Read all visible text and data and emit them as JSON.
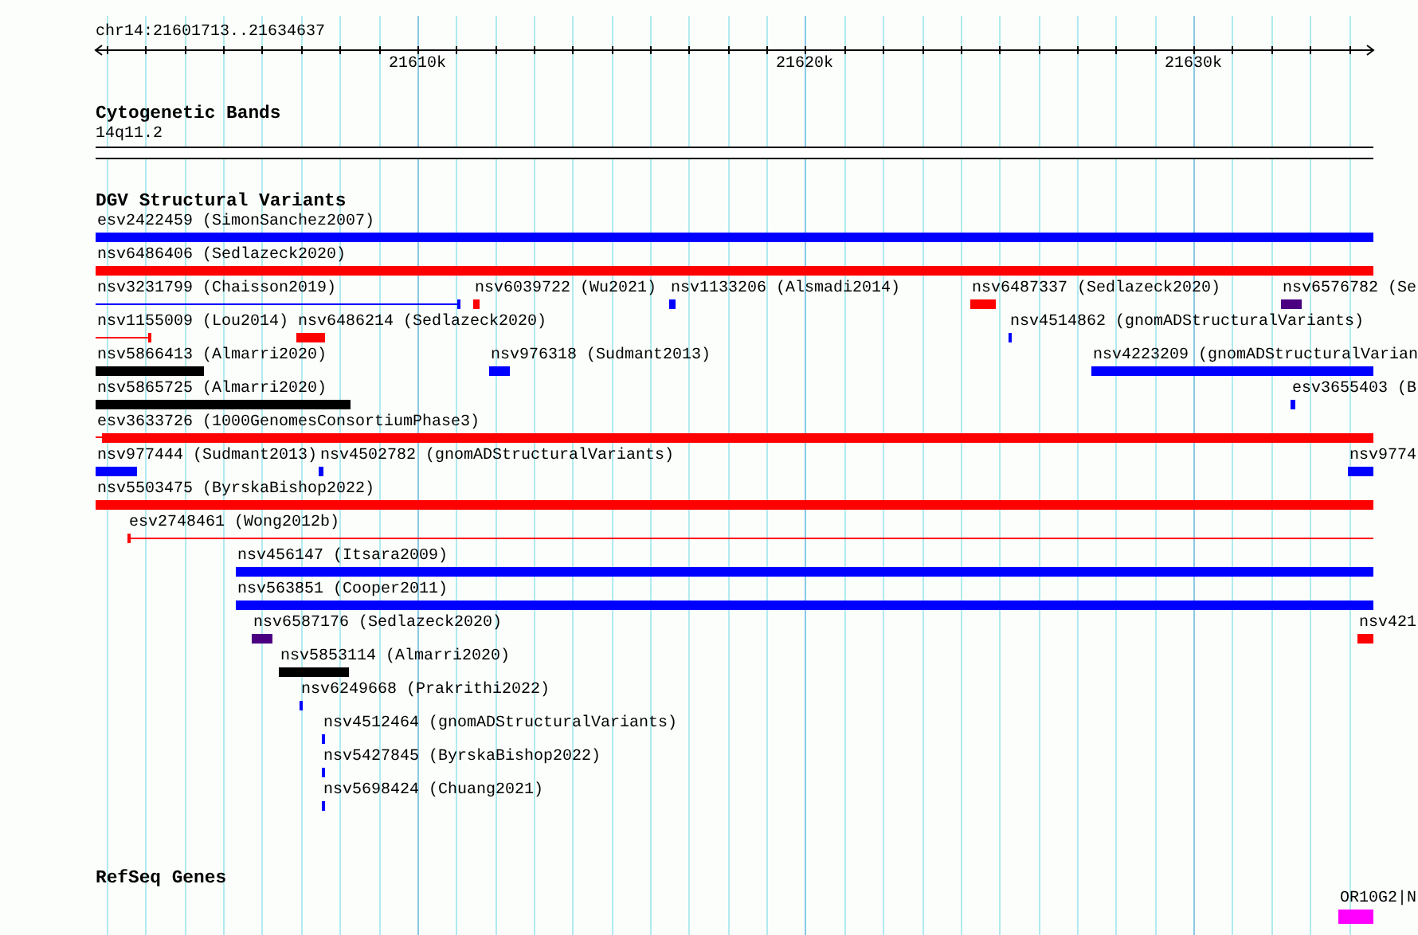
{
  "ruler": {
    "location": "chr14:21601713..21634637",
    "ticks": [
      {
        "label": "21610k"
      },
      {
        "label": "21620k"
      },
      {
        "label": "21630k"
      }
    ]
  },
  "cytoband_track": {
    "title": "Cytogenetic Bands",
    "band": "14q11.2"
  },
  "variant_track": {
    "title": "DGV Structural Variants",
    "rows": [
      [
        {
          "label": "esv2422459 (SimonSanchez2007)",
          "kind": "bar",
          "color": "#0000ff"
        }
      ],
      [
        {
          "label": "nsv6486406 (Sedlazeck2020)",
          "kind": "bar",
          "color": "#ff0000"
        }
      ],
      [
        {
          "label": "nsv3231799 (Chaisson2019)",
          "kind": "line",
          "color": "#0000ff"
        },
        {
          "label": "nsv6039722 (Wu2021)",
          "kind": "bar",
          "color": "#ff0000"
        },
        {
          "label": "nsv1133206 (Alsmadi2014)",
          "kind": "bar",
          "color": "#0000ff"
        },
        {
          "label": "nsv6487337 (Sedlazeck2020)",
          "kind": "bar",
          "color": "#ff0000"
        },
        {
          "label": "nsv6576782 (Se",
          "kind": "bar",
          "color": "#4b0082"
        }
      ],
      [
        {
          "label": "nsv1155009 (Lou2014)",
          "kind": "line",
          "color": "#ff0000"
        },
        {
          "label": "nsv6486214 (Sedlazeck2020)",
          "kind": "bar",
          "color": "#ff0000"
        },
        {
          "label": "nsv4514862 (gnomADStructuralVariants)",
          "kind": "bar",
          "color": "#0000ff"
        }
      ],
      [
        {
          "label": "nsv5866413 (Almarri2020)",
          "kind": "bar",
          "color": "#000000"
        },
        {
          "label": "nsv976318 (Sudmant2013)",
          "kind": "bar",
          "color": "#0000ff"
        },
        {
          "label": "nsv4223209 (gnomADStructuralVarian",
          "kind": "bar",
          "color": "#0000ff"
        }
      ],
      [
        {
          "label": "nsv5865725 (Almarri2020)",
          "kind": "bar",
          "color": "#000000"
        },
        {
          "label": "esv3655403 (B",
          "kind": "bar",
          "color": "#0000ff"
        }
      ],
      [
        {
          "label": "esv3633726 (1000GenomesConsortiumPhase3)",
          "kind": "bar",
          "color": "#ff0000"
        }
      ],
      [
        {
          "label": "nsv977444 (Sudmant2013)",
          "kind": "bar",
          "color": "#0000ff"
        },
        {
          "label": "nsv4502782 (gnomADStructuralVariants)",
          "kind": "bar",
          "color": "#0000ff"
        },
        {
          "label": "nsv9774",
          "kind": "bar",
          "color": "#0000ff"
        }
      ],
      [
        {
          "label": "nsv5503475 (ByrskaBishop2022)",
          "kind": "bar",
          "color": "#ff0000"
        }
      ],
      [
        {
          "label": "esv2748461 (Wong2012b)",
          "kind": "line",
          "color": "#ff0000"
        }
      ],
      [
        {
          "label": "nsv456147 (Itsara2009)",
          "kind": "bar",
          "color": "#0000ff"
        }
      ],
      [
        {
          "label": "nsv563851 (Cooper2011)",
          "kind": "bar",
          "color": "#0000ff"
        }
      ],
      [
        {
          "label": "nsv6587176 (Sedlazeck2020)",
          "kind": "bar",
          "color": "#4b0082"
        },
        {
          "label": "nsv421",
          "kind": "bar",
          "color": "#ff0000"
        }
      ],
      [
        {
          "label": "nsv5853114 (Almarri2020)",
          "kind": "bar",
          "color": "#000000"
        }
      ],
      [
        {
          "label": "nsv6249668 (Prakrithi2022)",
          "kind": "bar",
          "color": "#0000ff"
        }
      ],
      [
        {
          "label": "nsv4512464 (gnomADStructuralVariants)",
          "kind": "bar",
          "color": "#0000ff"
        }
      ],
      [
        {
          "label": "nsv5427845 (ByrskaBishop2022)",
          "kind": "bar",
          "color": "#0000ff"
        }
      ],
      [
        {
          "label": "nsv5698424 (Chuang2021)",
          "kind": "bar",
          "color": "#0000ff"
        }
      ]
    ]
  },
  "gene_track": {
    "title": "RefSeq Genes",
    "rows": [
      [
        {
          "label": "OR10G2|N",
          "kind": "gene",
          "color": "#ff00ff"
        }
      ]
    ]
  }
}
